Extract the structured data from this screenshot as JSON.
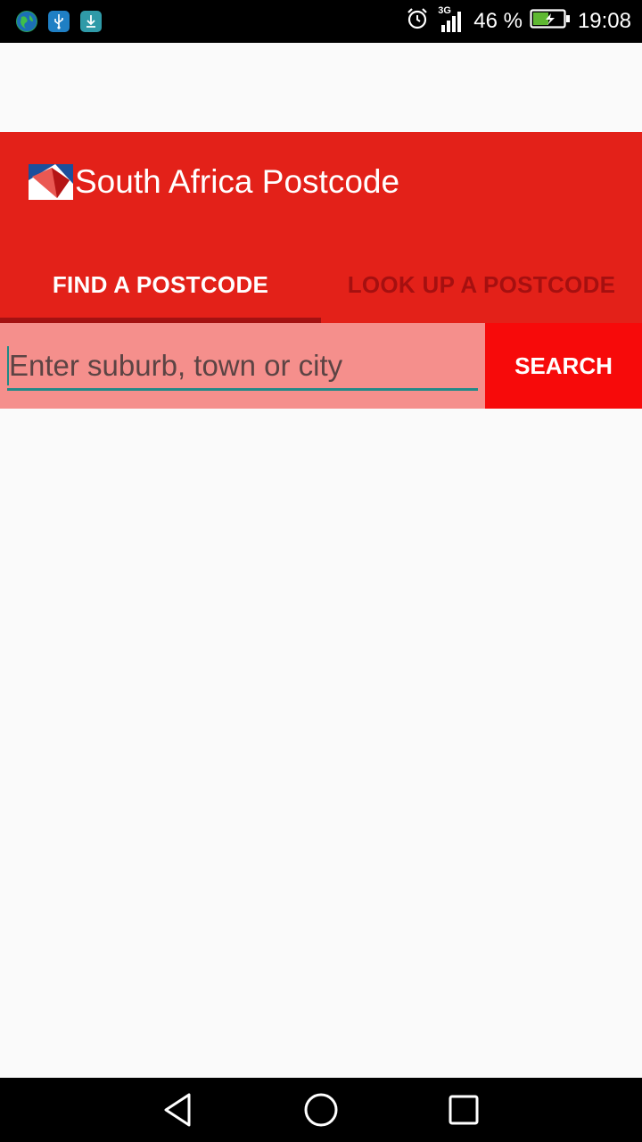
{
  "status_bar": {
    "network_type": "3G",
    "battery_percent": "46 %",
    "time": "19:08",
    "left_icons": [
      "globe-icon",
      "usb-icon",
      "download-icon"
    ],
    "right_icons": [
      "alarm-icon",
      "signal-icon",
      "battery-charging-icon"
    ]
  },
  "app_bar": {
    "title": "South Africa Postcode",
    "background_color": "#e32119"
  },
  "tabs": [
    {
      "label": "FIND A POSTCODE",
      "selected": true
    },
    {
      "label": "LOOK UP A POSTCODE",
      "selected": false
    }
  ],
  "search": {
    "placeholder": "Enter suburb, town or city",
    "value": "",
    "button_label": "SEARCH",
    "button_color": "#f70a0a"
  },
  "nav_bar": {
    "buttons": [
      "back-icon",
      "home-icon",
      "recents-icon"
    ]
  }
}
